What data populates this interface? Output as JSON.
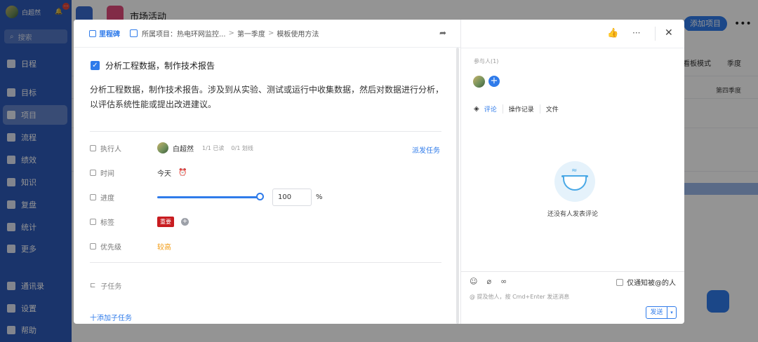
{
  "sidebar": {
    "user_name": "白超然",
    "search_placeholder": "搜索",
    "items": [
      {
        "label": "日程",
        "icon": "calendar-icon"
      },
      {
        "label": "目标",
        "icon": "target-icon"
      },
      {
        "label": "项目",
        "icon": "project-icon",
        "active": true
      },
      {
        "label": "流程",
        "icon": "flow-icon"
      },
      {
        "label": "绩效",
        "icon": "performance-icon"
      },
      {
        "label": "知识",
        "icon": "book-icon"
      },
      {
        "label": "复盘",
        "icon": "review-icon"
      },
      {
        "label": "统计",
        "icon": "pie-icon"
      },
      {
        "label": "更多",
        "icon": "grid-icon"
      }
    ],
    "bottom_items": [
      {
        "label": "通讯录",
        "icon": "contacts-icon"
      },
      {
        "label": "设置",
        "icon": "gear-icon"
      },
      {
        "label": "帮助",
        "icon": "help-icon"
      }
    ]
  },
  "background": {
    "project_title": "市场活动",
    "add_project_label": "添加项目",
    "view_mode_label": "看板模式",
    "season_label": "季度",
    "quarter_label": "第四季度"
  },
  "modal": {
    "milestone_label": "里程碑",
    "project_prefix": "所属项目：热电环网监控...",
    "breadcrumb_1": "第一季度",
    "breadcrumb_2": "模板使用方法",
    "task_title": "分析工程数据，制作技术报告",
    "description": "分析工程数据，制作技术报告。涉及到从实验、测试或运行中收集数据，然后对数据进行分析，以评估系统性能或提出改进建议。",
    "fields": {
      "executor_label": "执行人",
      "executor_name": "白超然",
      "read_status": "1/1 已读",
      "strike_status": "0/1 划线",
      "dispatch_label": "派发任务",
      "time_label": "时间",
      "time_value": "今天",
      "progress_label": "进度",
      "progress_value": "100",
      "progress_fraction": 1.0,
      "progress_unit": "%",
      "tag_label": "标签",
      "tag_value": "重要",
      "priority_label": "优先级",
      "priority_value": "较高"
    },
    "subtask_label": "子任务",
    "add_subtask_label": "十添加子任务"
  },
  "panel": {
    "participants_label": "参与人(1)",
    "tabs": [
      "评论",
      "操作记录",
      "文件"
    ],
    "empty_text": "还没有人发表评论",
    "notify_label": "仅通知被@的人",
    "comment_placeholder": "@ 提及他人，按 Cmd+Enter 发送消息",
    "send_label": "发送"
  },
  "colors": {
    "sidebar": "#2e5ab8",
    "accent": "#2f7bea",
    "tag_red": "#c81c20",
    "priority": "#f29b13"
  }
}
